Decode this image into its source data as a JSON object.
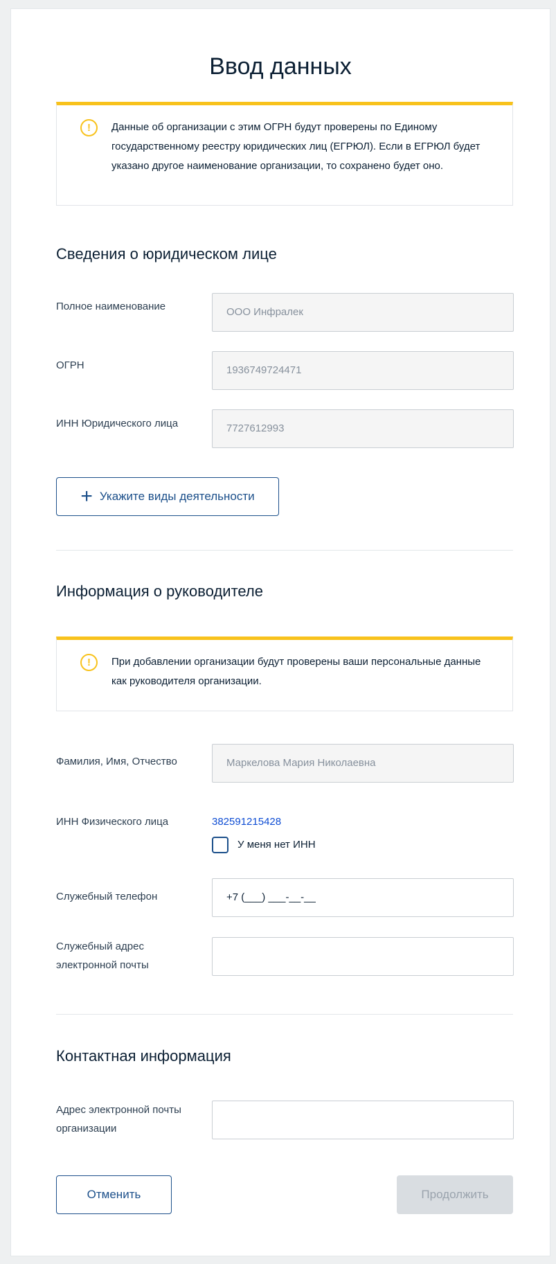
{
  "page": {
    "title": "Ввод данных"
  },
  "notice1": {
    "text": "Данные об организации с этим ОГРН будут проверены по Единому государственному реестру юридических лиц (ЕГРЮЛ). Если в ЕГРЮЛ будет указано другое наименование организации, то сохранено будет оно."
  },
  "legal": {
    "title": "Сведения о юридическом лице",
    "full_name_label": "Полное наименование",
    "full_name_value": "ООО Инфралек",
    "ogrn_label": "ОГРН",
    "ogrn_value": "1936749724471",
    "inn_label": "ИНН Юридического лица",
    "inn_value": "7727612993",
    "add_activities": "Укажите виды деятельности"
  },
  "head": {
    "title": "Информация о руководителе",
    "notice": "При добавлении организации будут проверены ваши персональные данные как руководителя организации.",
    "fio_label": "Фамилия, Имя, Отчество",
    "fio_value": "Маркелова Мария Николаевна",
    "inn_label": "ИНН Физического лица",
    "inn_value": "382591215428",
    "no_inn_label": "У меня нет ИНН",
    "phone_label": "Служебный телефон",
    "phone_value": "+7 (___) ___-__-__",
    "email_label": "Служебный адрес электронной почты",
    "email_value": ""
  },
  "contact": {
    "title": "Контактная информация",
    "email_label": "Адрес электронной почты организации",
    "email_value": ""
  },
  "actions": {
    "cancel": "Отменить",
    "continue": "Продолжить"
  },
  "colors": {
    "accent": "#f8c21c",
    "link": "#0d4cd3",
    "primary_text": "#0b1f33"
  }
}
